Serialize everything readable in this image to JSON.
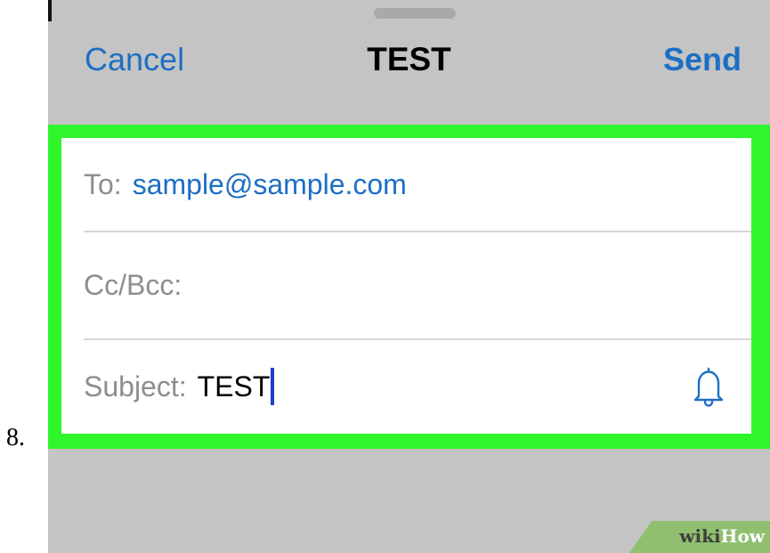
{
  "step": {
    "number": "8."
  },
  "nav": {
    "cancel_label": "Cancel",
    "title": "TEST",
    "send_label": "Send"
  },
  "form": {
    "to": {
      "label": "To:",
      "value": "sample@sample.com"
    },
    "cc": {
      "label": "Cc/Bcc:",
      "value": ""
    },
    "subject": {
      "label": "Subject:",
      "value": "TEST"
    }
  },
  "icons": {
    "notify": "bell-icon"
  },
  "colors": {
    "accent": "#1d6fc4",
    "highlight": "#2ff52b",
    "background": "#c4c4c4"
  },
  "watermark": {
    "part1": "wiki",
    "part2": "How"
  }
}
